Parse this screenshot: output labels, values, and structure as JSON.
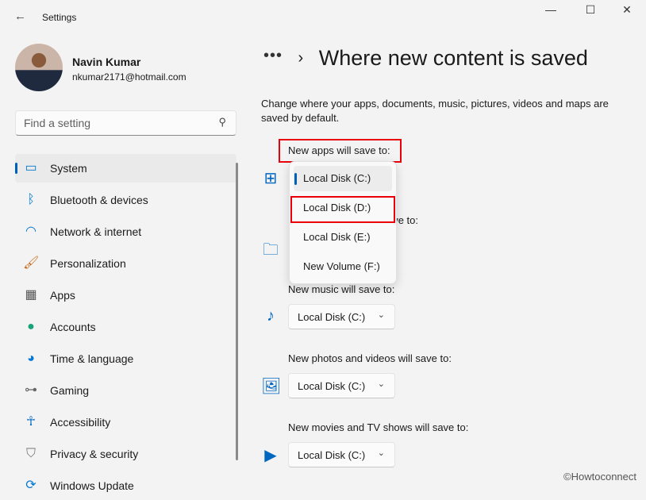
{
  "window": {
    "title": "Settings",
    "minimize": "—",
    "maximize": "☐",
    "close": "✕",
    "back": "←"
  },
  "user": {
    "name": "Navin Kumar",
    "email": "nkumar2171@hotmail.com"
  },
  "search": {
    "placeholder": "Find a setting",
    "icon": "search-icon"
  },
  "sidebar": {
    "items": [
      {
        "label": "System",
        "icon": "system-icon",
        "selected": true
      },
      {
        "label": "Bluetooth & devices",
        "icon": "bluetooth-icon"
      },
      {
        "label": "Network & internet",
        "icon": "wifi-icon"
      },
      {
        "label": "Personalization",
        "icon": "brush-icon"
      },
      {
        "label": "Apps",
        "icon": "apps-icon"
      },
      {
        "label": "Accounts",
        "icon": "person-icon"
      },
      {
        "label": "Time & language",
        "icon": "globe-clock-icon"
      },
      {
        "label": "Gaming",
        "icon": "gamepad-icon"
      },
      {
        "label": "Accessibility",
        "icon": "accessibility-icon"
      },
      {
        "label": "Privacy & security",
        "icon": "shield-icon"
      },
      {
        "label": "Windows Update",
        "icon": "update-icon"
      }
    ]
  },
  "main": {
    "breadcrumb_dots": "•••",
    "breadcrumb_sep": "›",
    "title": "Where new content is saved",
    "description": "Change where your apps, documents, music, pictures, videos and maps are saved by default.",
    "sections": [
      {
        "label": "New apps will save to:",
        "icon": "apps-drive-icon",
        "value": "Local Disk (C:)"
      },
      {
        "label": "New documents will save to:",
        "icon": "folder-icon",
        "value": "Local Disk (C:)"
      },
      {
        "label": "New music will save to:",
        "icon": "music-icon",
        "value": "Local Disk (C:)"
      },
      {
        "label": "New photos and videos will save to:",
        "icon": "photo-icon",
        "value": "Local Disk (C:)"
      },
      {
        "label": "New movies and TV shows will save to:",
        "icon": "video-icon",
        "value": "Local Disk (C:)"
      }
    ],
    "dropdown": {
      "options": [
        "Local Disk (C:)",
        "Local Disk (D:)",
        "Local Disk (E:)",
        "New Volume (F:)"
      ],
      "selected": "Local Disk (C:)",
      "highlighted": "Local Disk (D:)"
    }
  },
  "watermark": "©Howtoconnect",
  "colors": {
    "accent": "#005fb8",
    "highlight_box": "#e8000b"
  }
}
